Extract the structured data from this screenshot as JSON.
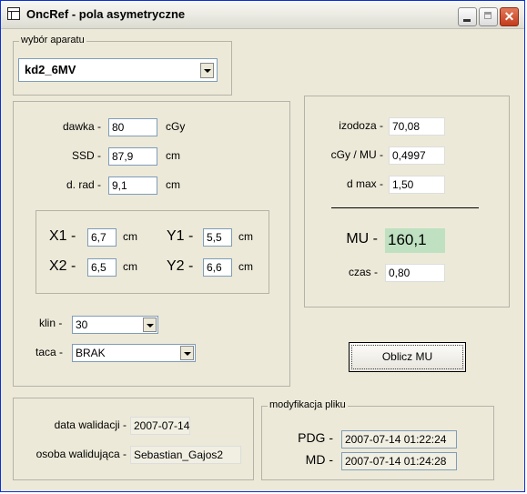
{
  "window": {
    "title": "OncRef - pola asymetryczne",
    "close_glyph": "✕"
  },
  "device": {
    "group_title": "wybór aparatu",
    "selected": "kd2_6MV"
  },
  "params": {
    "dose_label": "dawka -",
    "dose_value": "80",
    "dose_unit": "cGy",
    "ssd_label": "SSD -",
    "ssd_value": "87,9",
    "ssd_unit": "cm",
    "drad_label": "d. rad -",
    "drad_value": "9,1",
    "drad_unit": "cm"
  },
  "field": {
    "x1_label": "X1 -",
    "x1_value": "6,7",
    "x1_unit": "cm",
    "x2_label": "X2 -",
    "x2_value": "6,5",
    "x2_unit": "cm",
    "y1_label": "Y1 -",
    "y1_value": "5,5",
    "y1_unit": "cm",
    "y2_label": "Y2 -",
    "y2_value": "6,6",
    "y2_unit": "cm"
  },
  "wedge": {
    "label": "klin -",
    "value": "30"
  },
  "tray": {
    "label": "taca -",
    "value": "BRAK"
  },
  "results": {
    "isodose_label": "izodoza -",
    "isodose_value": "70,08",
    "cgymu_label": "cGy / MU -",
    "cgymu_value": "0,4997",
    "dmax_label": "d max -",
    "dmax_value": "1,50",
    "mu_label": "MU -",
    "mu_value": "160,1",
    "time_label": "czas -",
    "time_value": "0,80"
  },
  "compute_button": "Oblicz MU",
  "validation": {
    "date_label": "data walidacji -",
    "date_value": "2007-07-14",
    "person_label": "osoba walidująca -",
    "person_value": "Sebastian_Gajos2"
  },
  "file_mod": {
    "group_title": "modyfikacja pliku",
    "pdg_label": "PDG -",
    "pdg_value": "2007-07-14 01:22:24",
    "md_label": "MD -",
    "md_value": "2007-07-14 01:24:28"
  },
  "icons": [
    "app-window-icon",
    "minimize-icon",
    "maximize-icon",
    "close-icon",
    "chevron-down-icon"
  ],
  "colors": {
    "mu_highlight": "#bfe1c1",
    "window_bg": "#ece9d8",
    "close_button": "#c23b1b"
  }
}
